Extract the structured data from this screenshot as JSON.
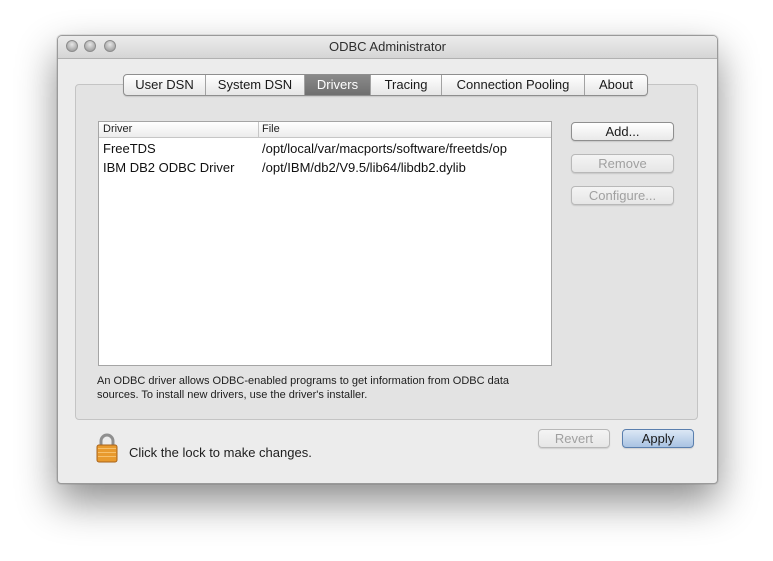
{
  "window": {
    "title": "ODBC Administrator"
  },
  "tabs": [
    {
      "label": "User DSN",
      "active": false
    },
    {
      "label": "System DSN",
      "active": false
    },
    {
      "label": "Drivers",
      "active": true
    },
    {
      "label": "Tracing",
      "active": false
    },
    {
      "label": "Connection Pooling",
      "active": false
    },
    {
      "label": "About",
      "active": false
    }
  ],
  "table": {
    "columns": [
      "Driver",
      "File"
    ],
    "rows": [
      {
        "driver": "FreeTDS",
        "file": "/opt/local/var/macports/software/freetds/op"
      },
      {
        "driver": "IBM DB2 ODBC Driver",
        "file": "/opt/IBM/db2/V9.5/lib64/libdb2.dylib"
      }
    ]
  },
  "side_buttons": {
    "add": "Add...",
    "remove": "Remove",
    "configure": "Configure..."
  },
  "info_text": {
    "line1": "An ODBC driver allows ODBC-enabled programs to get information from ODBC data",
    "line2": "sources. To install new drivers, use the driver's installer."
  },
  "footer": {
    "lock_label": "Click the lock to make changes.",
    "revert": "Revert",
    "apply": "Apply"
  },
  "colors": {
    "active_tab": "#7c7c7c",
    "apply_accent": "#a9c3e2",
    "lock_body": "#e89a2e"
  },
  "icons": {
    "lock": "padlock-icon"
  }
}
